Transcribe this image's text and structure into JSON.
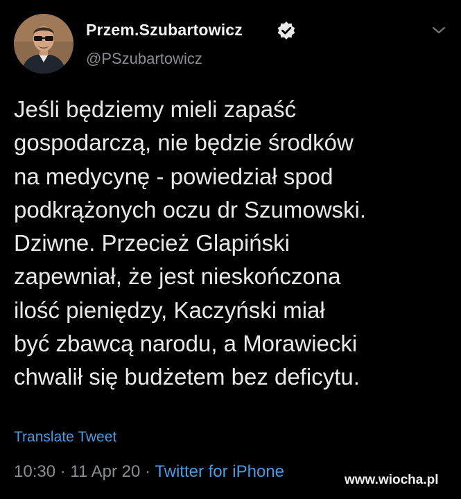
{
  "author": {
    "display_name": "Przem.Szubartowicz",
    "handle": "@PSzubartowicz",
    "verified_icon": "verified-badge-icon"
  },
  "menu": {
    "icon": "chevron-down-icon"
  },
  "tweet": {
    "lines": [
      "Jeśli będziemy mieli zapaść",
      "gospodarczą, nie będzie środków",
      "na medycynę - powiedział spod",
      "podkrążonych oczu dr Szumowski.",
      "Dziwne. Przecież Glapiński",
      "zapewniał, że jest nieskończona",
      "ilość pieniędzy, Kaczyński miał",
      "być zbawcą narodu, a Morawiecki",
      "chwalił się budżetem bez deficytu."
    ],
    "translate_label": "Translate Tweet",
    "time": "10:30",
    "separator": "·",
    "date": "11 Apr 20",
    "source": "Twitter for iPhone"
  },
  "watermark": "www.wiocha.pl",
  "colors": {
    "background": "#000000",
    "link": "#4a9be0",
    "muted": "#8a8d91",
    "text": "#e9e9e9"
  }
}
